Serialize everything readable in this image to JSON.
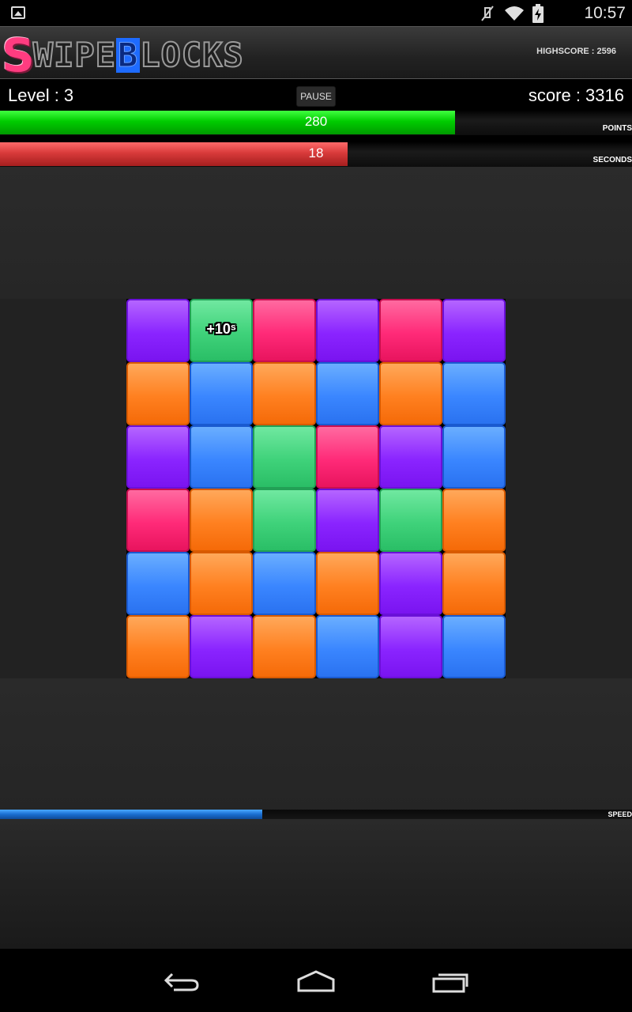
{
  "status_bar": {
    "time": "10:57",
    "icons": [
      "gallery-icon",
      "mute-icon",
      "wifi-icon",
      "battery-charging-icon"
    ]
  },
  "header": {
    "logo_text": {
      "first": "S",
      "part1": "WIPE",
      "b": "B",
      "part2": "LOCKS"
    },
    "highscore": "HIGHSCORE : 2596"
  },
  "info": {
    "level": "Level : 3",
    "pause_label": "PAUSE",
    "score": "score : 3316"
  },
  "bars": {
    "points": {
      "value": "280",
      "label": "POINTS",
      "fill_fraction": 0.72,
      "color": "#00cc00"
    },
    "seconds": {
      "value": "18",
      "label": "SECONDS",
      "fill_fraction": 0.55,
      "color": "#d83a3a"
    },
    "speed": {
      "label": "SPEED",
      "fill_fraction": 0.415,
      "color": "#1a6ed0"
    }
  },
  "board": {
    "columns": 6,
    "rows": [
      [
        "purple",
        "green",
        "pink",
        "purple",
        "pink",
        "purple"
      ],
      [
        "orange",
        "blue",
        "orange",
        "blue",
        "orange",
        "blue"
      ],
      [
        "purple",
        "blue",
        "green",
        "pink",
        "purple",
        "blue"
      ],
      [
        "pink",
        "orange",
        "green",
        "purple",
        "green",
        "orange"
      ],
      [
        "blue",
        "orange",
        "blue",
        "orange",
        "purple",
        "orange"
      ],
      [
        "orange",
        "purple",
        "orange",
        "blue",
        "purple",
        "blue"
      ]
    ],
    "bonus": {
      "row": 0,
      "col": 1,
      "text": "+10ˢ"
    },
    "colors": {
      "purple": "#8a24ff",
      "pink": "#ff2a78",
      "orange": "#ff8020",
      "blue": "#3a86ff",
      "green": "#3fd27a"
    }
  },
  "nav": {
    "back": "back-icon",
    "home": "home-icon",
    "recents": "recents-icon"
  }
}
